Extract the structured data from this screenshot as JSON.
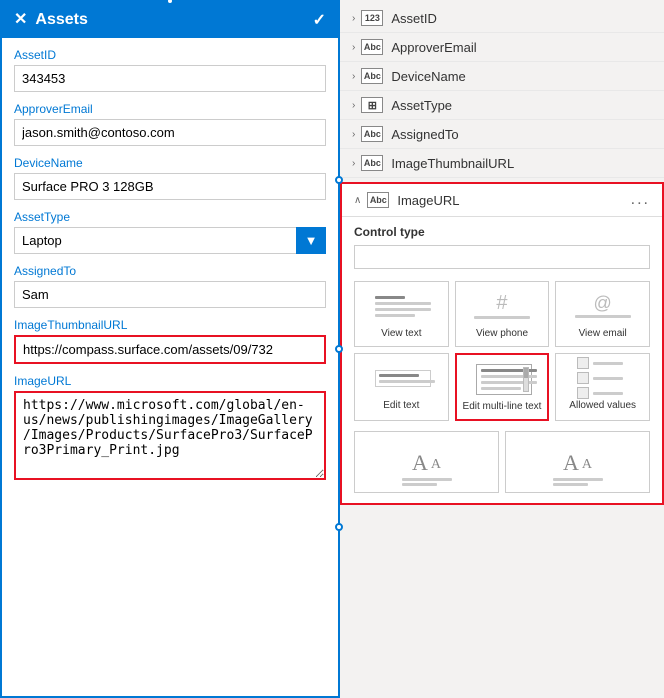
{
  "leftPanel": {
    "title": "Assets",
    "fields": [
      {
        "label": "AssetID",
        "value": "343453",
        "type": "input"
      },
      {
        "label": "ApproverEmail",
        "value": "jason.smith@contoso.com",
        "type": "input"
      },
      {
        "label": "DeviceName",
        "value": "Surface PRO 3 128GB",
        "type": "input"
      },
      {
        "label": "AssetType",
        "value": "Laptop",
        "type": "select"
      },
      {
        "label": "AssignedTo",
        "value": "Sam",
        "type": "input"
      },
      {
        "label": "ImageThumbnailURL",
        "value": "https://compass.surface.com/assets/09/732",
        "type": "input-highlight"
      },
      {
        "label": "ImageURL",
        "value": "https://www.microsoft.com/global/en-us/news/publishingimages/ImageGallery/Images/Products/SurfacePro3/SurfacePro3Primary_Print.jpg",
        "type": "textarea"
      }
    ]
  },
  "rightPanel": {
    "fieldList": [
      {
        "id": "AssetID",
        "chevron": "›",
        "typeLabel": "123",
        "typeClass": "number"
      },
      {
        "id": "ApproverEmail",
        "chevron": "›",
        "typeLabel": "Abc",
        "typeClass": "text"
      },
      {
        "id": "DeviceName",
        "chevron": "›",
        "typeLabel": "Abc",
        "typeClass": "text"
      },
      {
        "id": "AssetType",
        "chevron": "›",
        "typeLabel": "⊞",
        "typeClass": "grid"
      },
      {
        "id": "AssignedTo",
        "chevron": "›",
        "typeLabel": "Abc",
        "typeClass": "text"
      },
      {
        "id": "ImageThumbnailURL",
        "chevron": "›",
        "typeLabel": "Abc",
        "typeClass": "text"
      }
    ],
    "expandedField": {
      "label": "ImageURL",
      "typeLabel": "Abc",
      "controlTypeLabel": "Control type",
      "controlTypeValue": "",
      "dotsLabel": "...",
      "controls": [
        {
          "id": "view-text",
          "label": "View text",
          "iconType": "view-text"
        },
        {
          "id": "view-phone",
          "label": "View phone",
          "iconType": "view-phone"
        },
        {
          "id": "view-email",
          "label": "View email",
          "iconType": "view-email"
        },
        {
          "id": "edit-text",
          "label": "Edit text",
          "iconType": "edit-text"
        },
        {
          "id": "edit-multiline",
          "label": "Edit multi-line text",
          "iconType": "edit-multiline",
          "selected": true
        },
        {
          "id": "allowed-values",
          "label": "Allowed values",
          "iconType": "allowed-values"
        }
      ],
      "bottomControls": [
        {
          "id": "font-size-1",
          "label": "AA",
          "iconType": "font-1"
        },
        {
          "id": "font-size-2",
          "label": "AA",
          "iconType": "font-2"
        }
      ]
    }
  },
  "icons": {
    "close": "✕",
    "check": "✓",
    "chevronDown": "▼",
    "chevronRight": "›",
    "chevronExpanded": "∧"
  }
}
